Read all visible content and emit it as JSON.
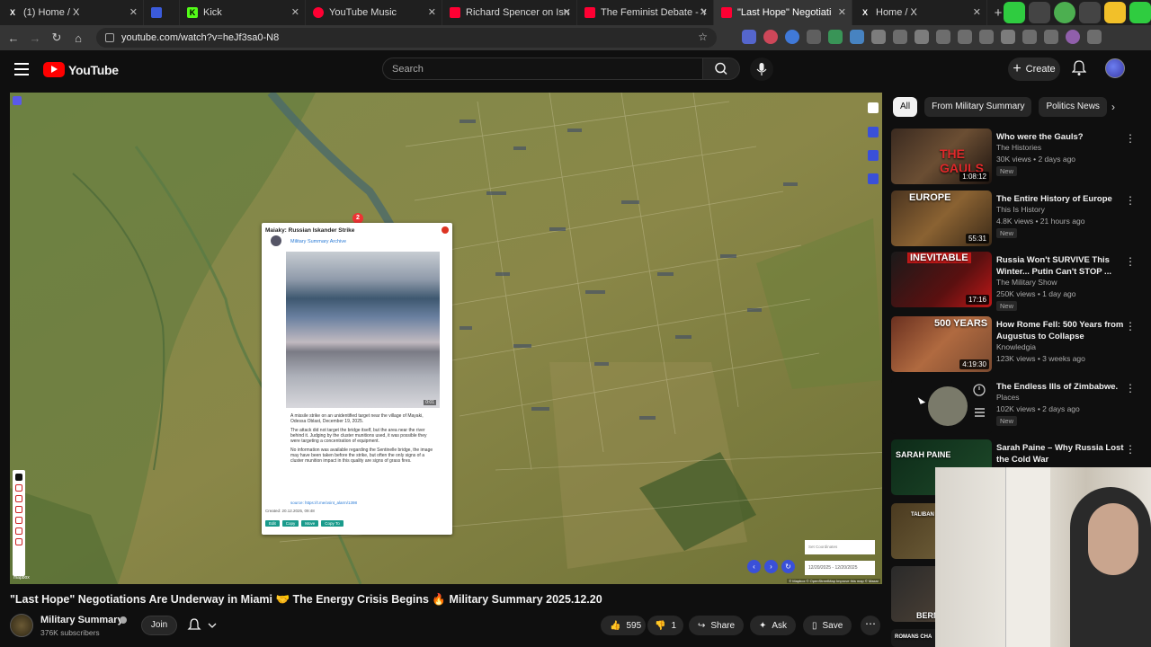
{
  "browser": {
    "tabs": [
      {
        "label": "(1) Home / X",
        "icon": "x-icon",
        "color": "#ffffff"
      },
      {
        "label": "",
        "icon": "mail-icon",
        "color": "#3b5bdb"
      },
      {
        "label": "Kick",
        "icon": "kick-icon",
        "color": "#53fc18"
      },
      {
        "label": "YouTube Music",
        "icon": "youtube-music-icon",
        "color": "#ff0033"
      },
      {
        "label": "Richard Spencer on Israel, Ch",
        "icon": "youtube-icon",
        "color": "#ff0033"
      },
      {
        "label": "The Feminist Debate - YouTu",
        "icon": "youtube-icon",
        "color": "#ff0033"
      },
      {
        "label": "\"Last Hope\" Negotiations",
        "icon": "youtube-icon",
        "color": "#ff0033"
      },
      {
        "label": "Home / X",
        "icon": "x-icon",
        "color": "#ffffff"
      }
    ],
    "url": "youtube.com/watch?v=heJf3sa0-N8"
  },
  "youtube": {
    "logo_text": "YouTube",
    "search_placeholder": "Search",
    "create_label": "Create"
  },
  "video": {
    "title": "\"Last Hope\" Negotiations Are Underway in Miami 🤝 The Energy Crisis Begins 🔥 Military Summary 2025.12.20",
    "channel": "Military Summary",
    "subscribers": "376K subscribers",
    "join_label": "Join",
    "likes": "595",
    "dislikes": "1",
    "share_label": "Share",
    "ask_label": "Ask",
    "save_label": "Save"
  },
  "map_popup": {
    "title": "Maiaky: Russian Iskander Strike",
    "channel": "Military Summary Archive",
    "duration": "0:01",
    "text1": "A missile strike on an unidentified target near the village of Mayaki, Odessa Oblast, December 19, 2025.",
    "text2": "The attack did not target the bridge itself, but the area near the river behind it. Judging by the cluster munitions used, it was possible they were targeting a concentration of equipment.",
    "text3": "No information was available regarding the Sentinelle bridge, the image may have been taken before the strike, but often the only signs of a cluster munition impact in this quality are signs of grass fires.",
    "source": "source: https://t.me/osint_alarm/1398",
    "created": "Created: 20.12.2025, 09:48",
    "buttons": [
      "Edit",
      "Copy",
      "Move",
      "Copy To"
    ],
    "marker_label": "2",
    "coord_placeholder": "Set Coordinates",
    "date_range": "12/20/2025 - 12/20/2025",
    "attribution": "© Mapbox © OpenStreetMap Improve this map © Maxar",
    "mapbox": "mapbox"
  },
  "chips": [
    "All",
    "From Military Summary",
    "Politics News"
  ],
  "recommendations": [
    {
      "title": "Who were the Gauls?",
      "channel": "The Histories",
      "meta": "30K views • 2 days ago",
      "badge": "New",
      "duration": "1:08:12",
      "thumb_text": "THE GAULS"
    },
    {
      "title": "The Entire History of Europe",
      "channel": "This Is History",
      "meta": "4.8K views • 21 hours ago",
      "badge": "New",
      "duration": "55:31",
      "thumb_text": "EUROPE"
    },
    {
      "title": "Russia Won't SURVIVE This Winter... Putin Can't STOP ...",
      "channel": "The Military Show",
      "meta": "250K views • 1 day ago",
      "badge": "New",
      "duration": "17:16",
      "thumb_text": "INEVITABLE"
    },
    {
      "title": "How Rome Fell: 500 Years from Augustus to Collapse",
      "channel": "Knowledgia",
      "meta": "123K views • 3 weeks ago",
      "badge": "",
      "duration": "4:19:30",
      "thumb_text": "500 YEARS"
    },
    {
      "title": "The Endless Ills of Zimbabwe.",
      "channel": "Places",
      "meta": "102K views • 2 days ago",
      "badge": "New",
      "duration": "",
      "thumb_text": ""
    },
    {
      "title": "Sarah Paine – Why Russia Lost the Cold War",
      "channel": "",
      "meta": "",
      "badge": "",
      "duration": "",
      "thumb_text": "SARAH PAINE"
    }
  ],
  "extra_thumbs": [
    "TALIBAN",
    "BERN",
    "ROMANS CHA"
  ],
  "colors": {
    "youtube_red": "#ff0000",
    "map_blue": "#3a50d9",
    "popup_button": "#1a9b8c"
  }
}
